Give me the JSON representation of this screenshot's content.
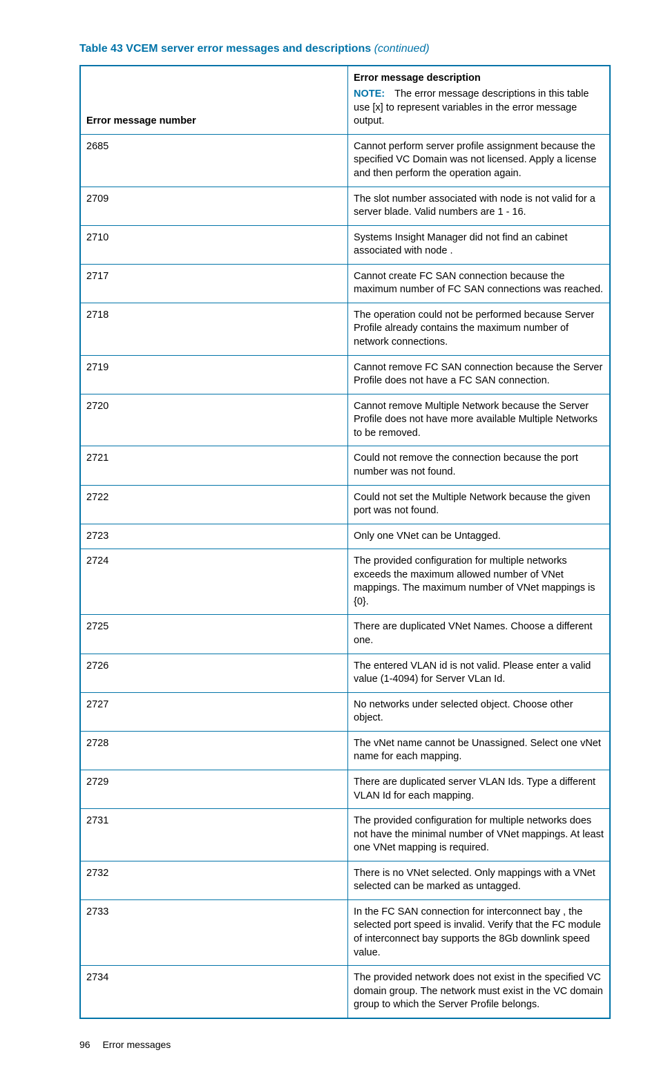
{
  "title": {
    "prefix": "Table 43 VCEM server error messages and descriptions",
    "suffix": "(continued)"
  },
  "columns": {
    "number": "Error message number",
    "description_heading": "Error message description",
    "note_label": "NOTE:",
    "note_text": "The error message descriptions in this table use [x] to represent variables in the error message output."
  },
  "rows": [
    {
      "num": "2685",
      "desc": "Cannot perform server profile assignment because the specified VC Domain was not licensed. Apply a license and then perform the operation again."
    },
    {
      "num": "2709",
      "desc": "The slot number associated with node is not valid for a server blade. Valid numbers are 1 - 16."
    },
    {
      "num": "2710",
      "desc": "Systems Insight Manager did not find an cabinet associated with node ."
    },
    {
      "num": "2717",
      "desc": "Cannot create FC SAN connection because the maximum number of FC SAN connections was reached."
    },
    {
      "num": "2718",
      "desc": "The operation could not be performed because Server Profile already contains the maximum number of network connections."
    },
    {
      "num": "2719",
      "desc": "Cannot remove FC SAN connection because the Server Profile does not have a FC SAN connection."
    },
    {
      "num": "2720",
      "desc": "Cannot remove Multiple Network because the Server Profile does not have more available Multiple Networks to be removed."
    },
    {
      "num": "2721",
      "desc": "Could not remove the connection because the port number was not found."
    },
    {
      "num": "2722",
      "desc": "Could not set the Multiple Network because the given port was not found."
    },
    {
      "num": "2723",
      "desc": "Only one VNet can be Untagged."
    },
    {
      "num": "2724",
      "desc": "The provided configuration for multiple networks exceeds the maximum allowed number of VNet mappings. The maximum number of VNet mappings is {0}."
    },
    {
      "num": "2725",
      "desc": "There are duplicated VNet Names. Choose a different one."
    },
    {
      "num": "2726",
      "desc": "The entered VLAN id is not valid. Please enter a valid value (1-4094) for Server VLan Id."
    },
    {
      "num": "2727",
      "desc": "No networks under selected object. Choose other object."
    },
    {
      "num": "2728",
      "desc": "The vNet name cannot be Unassigned. Select one vNet name for each mapping."
    },
    {
      "num": "2729",
      "desc": "There are duplicated server VLAN Ids. Type a different VLAN Id for each mapping."
    },
    {
      "num": "2731",
      "desc": "The provided configuration for multiple networks does not have the minimal number of VNet mappings. At least one VNet mapping is required."
    },
    {
      "num": "2732",
      "desc": "There is no VNet selected. Only mappings with a VNet selected can be marked as untagged."
    },
    {
      "num": "2733",
      "desc": "In the FC SAN connection for interconnect bay , the selected port speed is invalid. Verify that the FC module of interconnect bay supports the 8Gb downlink speed value."
    },
    {
      "num": "2734",
      "desc": "The provided network does not exist in the specified VC domain group. The network must exist in the VC domain group to which the Server Profile belongs."
    }
  ],
  "footer": {
    "page_number": "96",
    "section": "Error messages"
  }
}
